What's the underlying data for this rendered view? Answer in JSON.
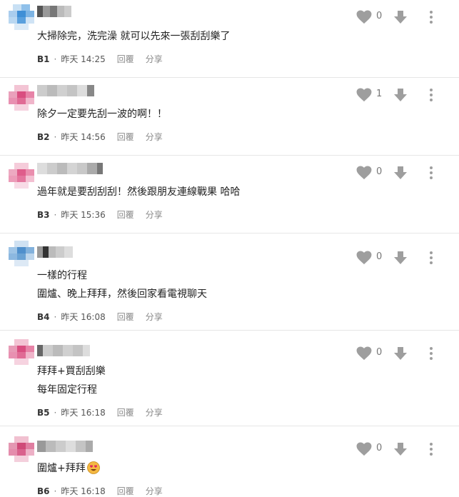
{
  "comments": [
    {
      "floor": "B1",
      "time": "昨天 14:25",
      "likes": "0",
      "lines": [
        "大掃除完，洗完澡 就可以先來一張刮刮樂了"
      ],
      "avatar_color": "#6aa9e0",
      "name_color": "#8a8a8a"
    },
    {
      "floor": "B2",
      "time": "昨天 14:56",
      "likes": "1",
      "lines": [
        "除夕一定要先刮一波的啊！！"
      ],
      "avatar_color": "#e06d96",
      "name_color": "#a0a0a0"
    },
    {
      "floor": "B3",
      "time": "昨天 15:36",
      "likes": "0",
      "lines": [
        "過年就是要刮刮刮！然後跟朋友連線戰果 哈哈"
      ],
      "avatar_color": "#e5789d",
      "name_color": "#a0a0a0"
    },
    {
      "floor": "B4",
      "time": "昨天 16:08",
      "likes": "0",
      "lines": [
        "一樣的行程",
        "圍爐、晚上拜拜，然後回家看電視聊天"
      ],
      "avatar_color": "#6fa3d6",
      "name_color": "#707070"
    },
    {
      "floor": "B5",
      "time": "昨天 16:18",
      "likes": "0",
      "lines": [
        "拜拜+買刮刮樂",
        "每年固定行程"
      ],
      "avatar_color": "#e06d96",
      "name_color": "#a0a0a0"
    },
    {
      "floor": "B6",
      "time": "昨天 16:18",
      "likes": "0",
      "lines": [
        "圍爐+拜拜"
      ],
      "avatar_color": "#d86a8c",
      "name_color": "#9a9a9a"
    }
  ],
  "actions": {
    "reply": "回覆",
    "share": "分享",
    "separator": "·"
  },
  "icons": {
    "like": "heart-icon",
    "dislike": "arrow-down-icon",
    "more": "more-vertical-icon",
    "emoji": "heart-eyes-emoji-icon"
  },
  "colors": {
    "icon_gray": "#9e9e9e",
    "divider": "#e6e6e6"
  }
}
